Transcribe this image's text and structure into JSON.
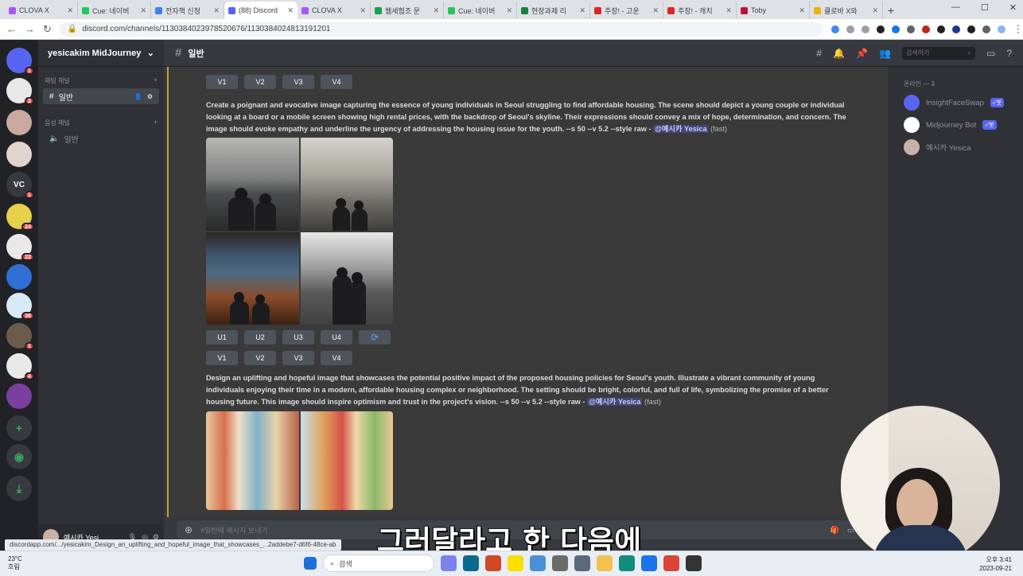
{
  "browser": {
    "tabs": [
      {
        "title": "CLOVA X",
        "color": "#a855f7",
        "active": false
      },
      {
        "title": "Cue: 네이버",
        "color": "#22c55e",
        "active": false
      },
      {
        "title": "전자책 신청",
        "color": "#3b82f6",
        "active": false
      },
      {
        "title": "(88) Discord",
        "color": "#5865f2",
        "active": true
      },
      {
        "title": "CLOVA X",
        "color": "#a855f7",
        "active": false
      },
      {
        "title": "웹세협조 문",
        "color": "#16a34a",
        "active": false
      },
      {
        "title": "Cue: 네이버",
        "color": "#22c55e",
        "active": false
      },
      {
        "title": "현장과제 리",
        "color": "#15803d",
        "active": false
      },
      {
        "title": "주장! - 고운",
        "color": "#dc2626",
        "active": false
      },
      {
        "title": "주장! - 캐치",
        "color": "#dc2626",
        "active": false
      },
      {
        "title": "Toby",
        "color": "#be123c",
        "active": false
      },
      {
        "title": "클로바 X와",
        "color": "#eab308",
        "active": false
      }
    ],
    "url": "discord.com/channels/1130384023978520676/1130384024813191201"
  },
  "discord": {
    "server_name": "yesicakim MidJourney",
    "text_category": "채팅 채널",
    "voice_category": "음성 채널",
    "text_channel": "일반",
    "voice_channel": "일반",
    "user_name": "예시카 Yesi...",
    "guilds": [
      {
        "label": "",
        "color": "#5865f2",
        "badge": "1"
      },
      {
        "label": "",
        "color": "#e8e8e8",
        "badge": "2"
      },
      {
        "label": "",
        "color": "#c9a8a0",
        "badge": ""
      },
      {
        "label": "",
        "color": "#e0d4cc",
        "badge": ""
      },
      {
        "label": "VC",
        "color": "#36393f",
        "badge": "1"
      },
      {
        "label": "",
        "color": "#e5d14a",
        "badge": "24"
      },
      {
        "label": "",
        "color": "#e8e8e8",
        "badge": "22"
      },
      {
        "label": "",
        "color": "#2f6fd6",
        "badge": ""
      },
      {
        "label": "",
        "color": "#d9e8f5",
        "badge": "38"
      },
      {
        "label": "",
        "color": "#6b5b4b",
        "badge": "1"
      },
      {
        "label": "",
        "color": "#e8e8e8",
        "badge": "4"
      },
      {
        "label": "",
        "color": "#7b3fa0",
        "badge": ""
      }
    ],
    "channel_header": "일반",
    "search_placeholder": "검색하기",
    "composer_placeholder": "#일반에 메시지 보내기",
    "buttons_v": [
      "V1",
      "V2",
      "V3",
      "V4"
    ],
    "buttons_u": [
      "U1",
      "U2",
      "U3",
      "U4"
    ],
    "message1": {
      "prompt": "Create a poignant and evocative image capturing the essence of young individuals in Seoul struggling to find affordable housing. The scene should depict a young couple or individual looking at a board or a mobile screen showing high rental prices, with the backdrop of Seoul's skyline. Their expressions should convey a mix of hope, determination, and concern. The image should evoke empathy and underline the urgency of addressing the housing issue for the youth. --s 50 --v 5.2 --style raw",
      "mention": "@예시카 Yesica",
      "speed": "(fast)"
    },
    "message2": {
      "prompt": "Design an uplifting and hopeful image that showcases the potential positive impact of the proposed housing policies for Seoul's youth. Illustrate a vibrant community of young individuals enjoying their time in a modern, affordable housing complex or neighborhood. The setting should be bright, colorful, and full of life, symbolizing the promise of a better housing future. This image should inspire optimism and trust in the project's vision. --s 50 --v 5.2 --style raw",
      "mention": "@예시카 Yesica",
      "speed": "(fast)"
    },
    "members_group": "온라인 — 3",
    "members": [
      {
        "name": "InsightFaceSwap",
        "bot": "✓봇",
        "color": "#5865f2"
      },
      {
        "name": "Midjourney Bot",
        "bot": "✓봇",
        "color": "#ffffff"
      },
      {
        "name": "예시카 Yesica",
        "bot": "",
        "color": "#c7b2a8"
      }
    ]
  },
  "status_url": "discordapp.com/.../yesicakim_Design_an_uplifting_and_hopeful_image_that_showcases_...2addebe7-d6f6-48ce-ab",
  "subtitle": "그러달라고 한 다음에",
  "taskbar": {
    "weather_temp": "23°C",
    "weather_desc": "흐림",
    "search": "검색",
    "time": "오후 3:41",
    "date": "2023-09-21"
  }
}
